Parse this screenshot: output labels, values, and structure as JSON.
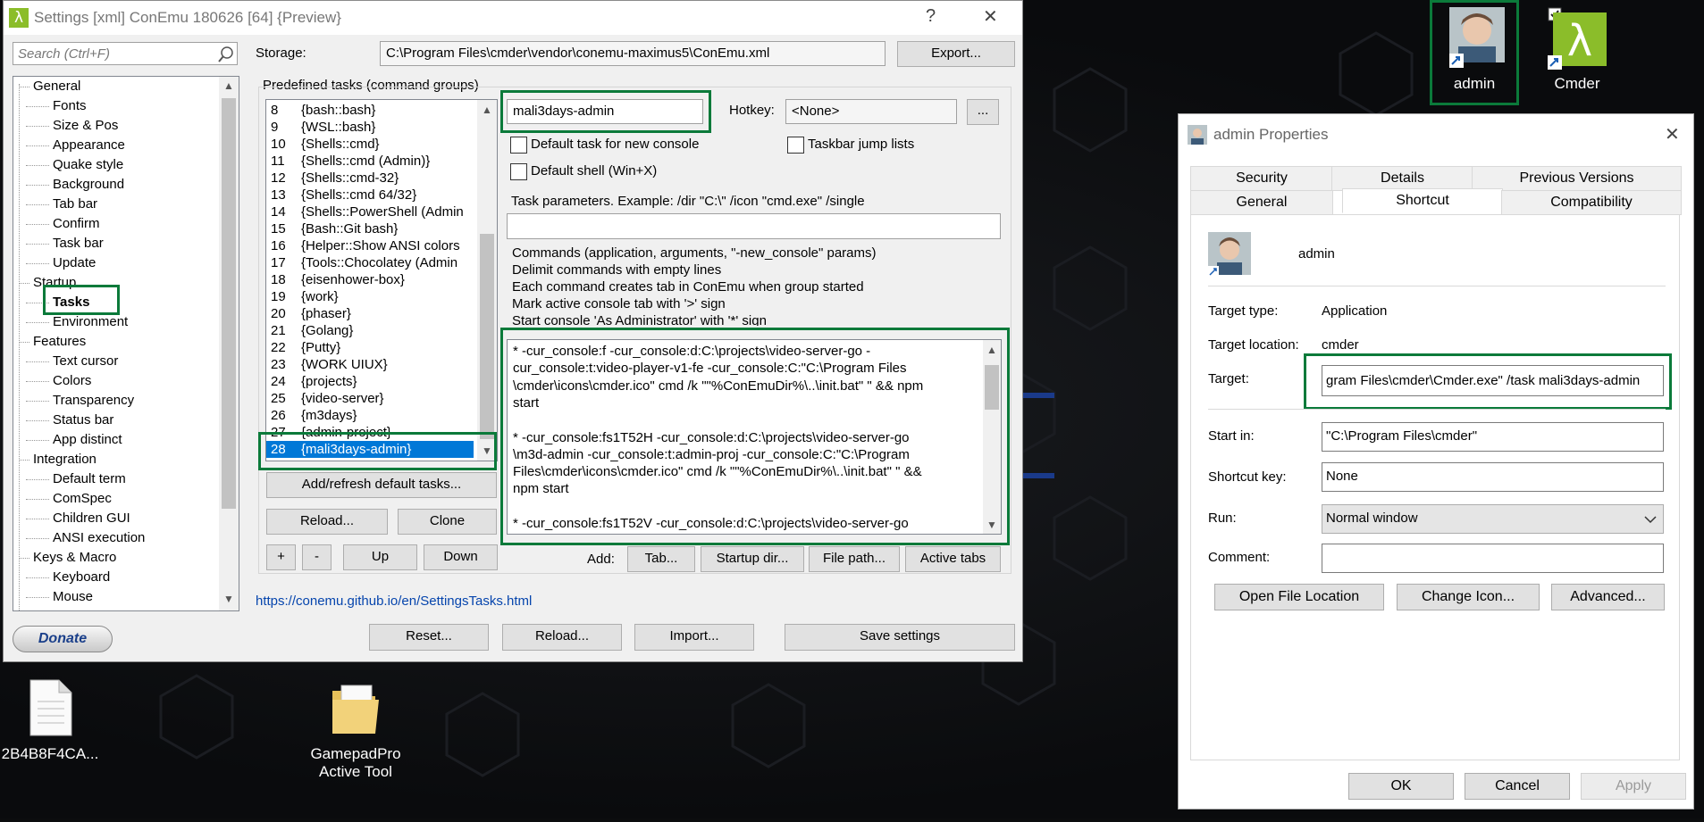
{
  "conemu": {
    "title": "Settings [xml] ConEmu 180626 [64] {Preview}",
    "help_glyph": "?",
    "close_glyph": "✕",
    "search_placeholder": "Search (Ctrl+F)",
    "tree": [
      {
        "label": "General",
        "level": 0
      },
      {
        "label": "Fonts",
        "level": 1
      },
      {
        "label": "Size & Pos",
        "level": 1
      },
      {
        "label": "Appearance",
        "level": 1
      },
      {
        "label": "Quake style",
        "level": 1
      },
      {
        "label": "Background",
        "level": 1
      },
      {
        "label": "Tab bar",
        "level": 1
      },
      {
        "label": "Confirm",
        "level": 1
      },
      {
        "label": "Task bar",
        "level": 1
      },
      {
        "label": "Update",
        "level": 1
      },
      {
        "label": "Startup",
        "level": 0
      },
      {
        "label": "Tasks",
        "level": 1,
        "selected": true
      },
      {
        "label": "Environment",
        "level": 1
      },
      {
        "label": "Features",
        "level": 0
      },
      {
        "label": "Text cursor",
        "level": 1
      },
      {
        "label": "Colors",
        "level": 1
      },
      {
        "label": "Transparency",
        "level": 1
      },
      {
        "label": "Status bar",
        "level": 1
      },
      {
        "label": "App distinct",
        "level": 1
      },
      {
        "label": "Integration",
        "level": 0
      },
      {
        "label": "Default term",
        "level": 1
      },
      {
        "label": "ComSpec",
        "level": 1
      },
      {
        "label": "Children GUI",
        "level": 1
      },
      {
        "label": "ANSI execution",
        "level": 1
      },
      {
        "label": "Keys & Macro",
        "level": 0
      },
      {
        "label": "Keyboard",
        "level": 1
      },
      {
        "label": "Mouse",
        "level": 1
      }
    ],
    "donate_label": "Donate",
    "storage_label": "Storage:",
    "storage_value": "C:\\Program Files\\cmder\\vendor\\conemu-maximus5\\ConEmu.xml",
    "export_label": "Export...",
    "predefined_label": "Predefined tasks (command groups)",
    "tasks": [
      {
        "num": "8",
        "name": "{bash::bash}"
      },
      {
        "num": "9",
        "name": "{WSL::bash}"
      },
      {
        "num": "10",
        "name": "{Shells::cmd}"
      },
      {
        "num": "11",
        "name": "{Shells::cmd (Admin)}"
      },
      {
        "num": "12",
        "name": "{Shells::cmd-32}"
      },
      {
        "num": "13",
        "name": "{Shells::cmd 64/32}"
      },
      {
        "num": "14",
        "name": "{Shells::PowerShell (Admin"
      },
      {
        "num": "15",
        "name": "{Bash::Git bash}"
      },
      {
        "num": "16",
        "name": "{Helper::Show ANSI colors"
      },
      {
        "num": "17",
        "name": "{Tools::Chocolatey (Admin"
      },
      {
        "num": "18",
        "name": "{eisenhower-box}"
      },
      {
        "num": "19",
        "name": "{work}"
      },
      {
        "num": "20",
        "name": "{phaser}"
      },
      {
        "num": "21",
        "name": "{Golang}"
      },
      {
        "num": "22",
        "name": "{Putty}"
      },
      {
        "num": "23",
        "name": "{WORK UIUX}"
      },
      {
        "num": "24",
        "name": "{projects}"
      },
      {
        "num": "25",
        "name": "{video-server}"
      },
      {
        "num": "26",
        "name": "{m3days}"
      },
      {
        "num": "27",
        "name": "{admin-project}"
      },
      {
        "num": "28",
        "name": "{mali3days-admin}",
        "selected": true
      }
    ],
    "add_refresh_label": "Add/refresh default tasks...",
    "reload_small_label": "Reload...",
    "clone_label": "Clone",
    "plus_label": "+",
    "minus_label": "-",
    "up_label": "Up",
    "down_label": "Down",
    "task_name_value": "mali3days-admin",
    "hotkey_label": "Hotkey:",
    "hotkey_value": "<None>",
    "hotkey_more": "...",
    "default_task_label": "Default task for new console",
    "taskbar_jump_label": "Taskbar jump lists",
    "default_shell_label": "Default shell (Win+X)",
    "task_params_label": "Task parameters. Example: /dir \"C:\\\" /icon \"cmd.exe\" /single",
    "task_params_value": "",
    "commands_help": [
      "Commands (application, arguments, \"-new_console\" params)",
      "Delimit commands with empty lines",
      "Each command creates tab in ConEmu when group started",
      "Mark active console tab with '>' sign",
      "Start console 'As Administrator' with '*' sign"
    ],
    "commands_text": [
      "* -cur_console:f -cur_console:d:C:\\projects\\video-server-go -",
      "cur_console:t:video-player-v1-fe -cur_console:C:\"C:\\Program Files",
      "\\cmder\\icons\\cmder.ico\" cmd /k \"\"%ConEmuDir%\\..\\init.bat\" \" && npm",
      "start",
      "",
      "* -cur_console:fs1T52H -cur_console:d:C:\\projects\\video-server-go",
      "\\m3d-admin -cur_console:t:admin-proj -cur_console:C:\"C:\\Program",
      "Files\\cmder\\icons\\cmder.ico\" cmd /k \"\"%ConEmuDir%\\..\\init.bat\" \" &&",
      "npm start",
      "",
      "* -cur_console:fs1T52V -cur_console:d:C:\\projects\\video-server-go"
    ],
    "add_label": "Add:",
    "add_tab_label": "Tab...",
    "startup_dir_label": "Startup dir...",
    "file_path_label": "File path...",
    "active_tabs_label": "Active tabs",
    "help_link": "https://conemu.github.io/en/SettingsTasks.html",
    "reset_label": "Reset...",
    "reload_label": "Reload...",
    "import_label": "Import...",
    "save_label": "Save settings"
  },
  "desktop": {
    "file1_label": "2B4B8F4CA...",
    "file2_label_line1": "GamepadPro",
    "file2_label_line2": "Active Tool",
    "admin_label": "admin",
    "cmder_label": "Cmder"
  },
  "props": {
    "title": "admin Properties",
    "close_glyph": "✕",
    "tabs_row1": [
      "Security",
      "Details",
      "Previous Versions"
    ],
    "tabs_row2": [
      "General",
      "Shortcut",
      "Compatibility"
    ],
    "name": "admin",
    "target_type_label": "Target type:",
    "target_type_value": "Application",
    "target_location_label": "Target location:",
    "target_location_value": "cmder",
    "target_label": "Target:",
    "target_value": "gram Files\\cmder\\Cmder.exe\" /task mali3days-admin",
    "start_in_label": "Start in:",
    "start_in_value": "\"C:\\Program Files\\cmder\"",
    "shortcut_key_label": "Shortcut key:",
    "shortcut_key_value": "None",
    "run_label": "Run:",
    "run_value": "Normal window",
    "comment_label": "Comment:",
    "comment_value": "",
    "open_location_label": "Open File Location",
    "change_icon_label": "Change Icon...",
    "advanced_label": "Advanced...",
    "ok_label": "OK",
    "cancel_label": "Cancel",
    "apply_label": "Apply"
  },
  "colors": {
    "highlight_green": "#0b7a3a",
    "selection_blue": "#0078d7"
  }
}
